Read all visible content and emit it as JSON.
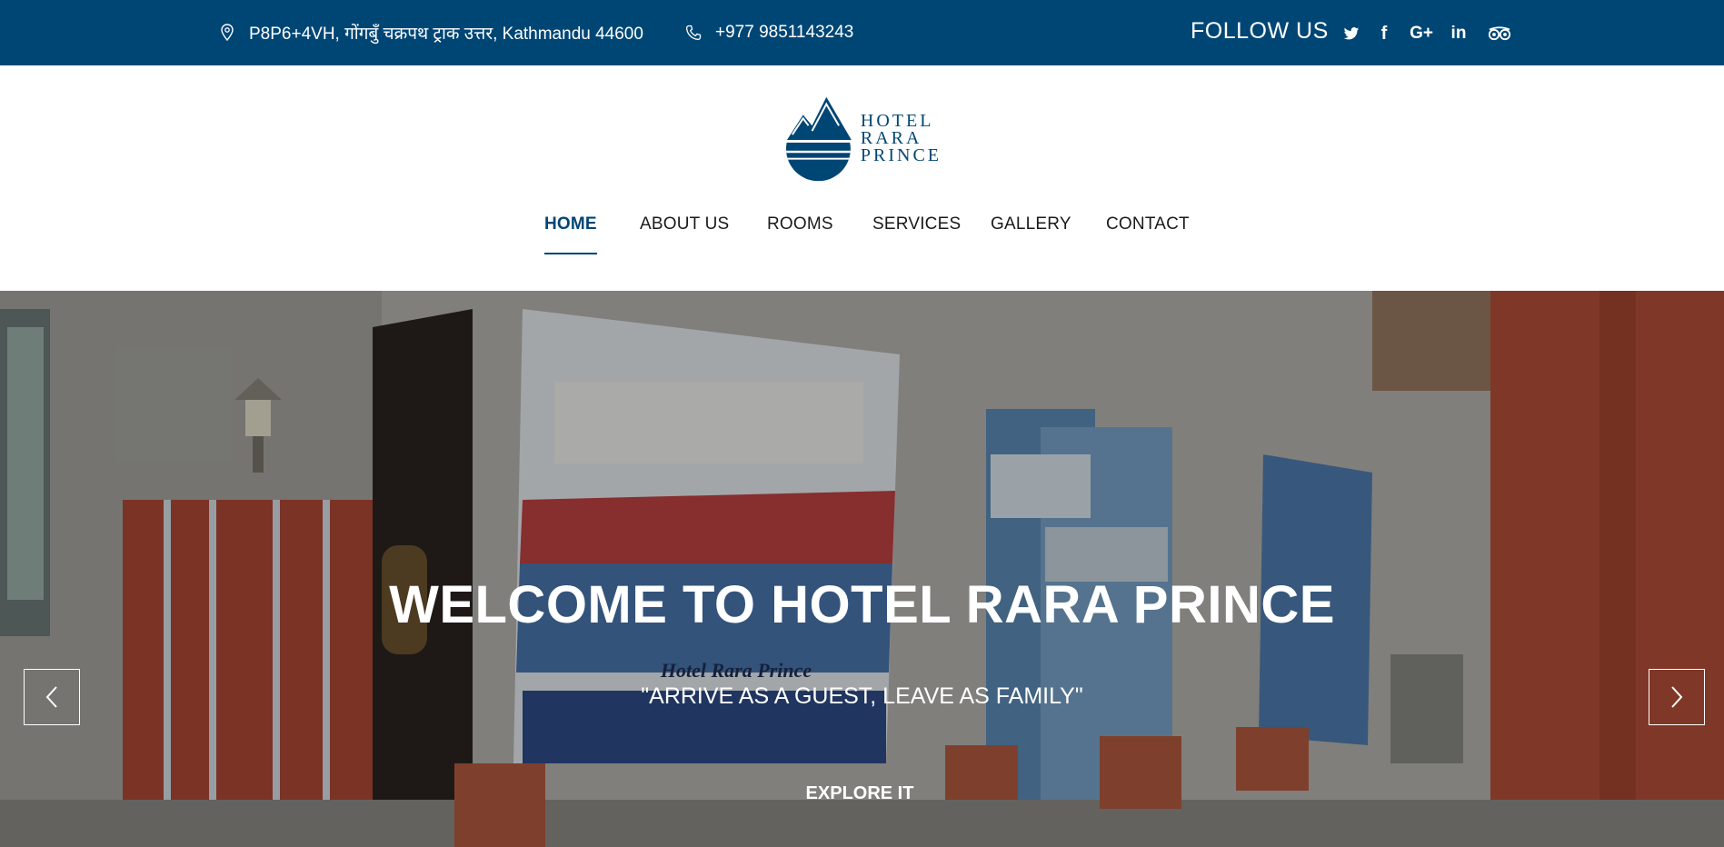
{
  "topbar": {
    "address": "P8P6+4VH, गोंगबुँ चक्रपथ ट्राक उत्तर, Kathmandu 44600",
    "phone": "+977 9851143243",
    "follow_label": "FOLLOW US",
    "social": {
      "twitter": "twitter-icon",
      "facebook": "f",
      "googleplus": "G+",
      "linkedin": "in",
      "tripadvisor": "tripadvisor-icon"
    }
  },
  "logo": {
    "line1": "HOTEL",
    "line2": "RARA",
    "line3": "PRINCE"
  },
  "nav": {
    "items": [
      {
        "label": "HOME",
        "active": true
      },
      {
        "label": "ABOUT US"
      },
      {
        "label": "ROOMS"
      },
      {
        "label": "SERVICES"
      },
      {
        "label": "GALLERY"
      },
      {
        "label": "CONTACT"
      }
    ]
  },
  "hero": {
    "title": "WELCOME TO HOTEL RARA PRINCE",
    "subtitle": "\"ARRIVE AS A GUEST, LEAVE AS FAMILY\"",
    "button": "EXPLORE IT",
    "banner_text": "Hotel Rara Prince"
  },
  "colors": {
    "brand": "#004675",
    "text_dark": "#1a1a1a",
    "white": "#ffffff"
  }
}
